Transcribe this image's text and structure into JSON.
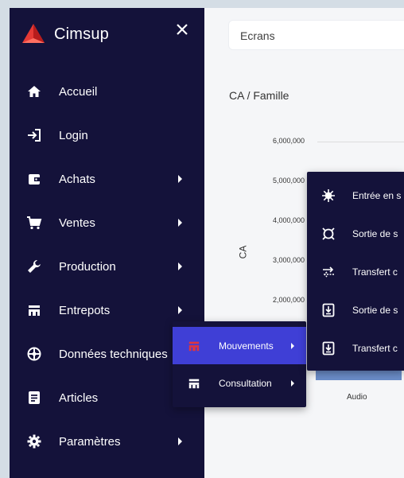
{
  "app": {
    "name": "Cimsup"
  },
  "sidebar": {
    "items": [
      {
        "label": "Accueil",
        "icon": "home-icon",
        "submenu": false
      },
      {
        "label": "Login",
        "icon": "login-icon",
        "submenu": false
      },
      {
        "label": "Achats",
        "icon": "wallet-icon",
        "submenu": true
      },
      {
        "label": "Ventes",
        "icon": "cart-icon",
        "submenu": true
      },
      {
        "label": "Production",
        "icon": "wrench-icon",
        "submenu": true
      },
      {
        "label": "Entrepots",
        "icon": "warehouse-icon",
        "submenu": true
      },
      {
        "label": "Données techniques",
        "icon": "settings-wheel-icon",
        "submenu": false
      },
      {
        "label": "Articles",
        "icon": "document-icon",
        "submenu": false
      },
      {
        "label": "Paramètres",
        "icon": "gear-icon",
        "submenu": true
      }
    ]
  },
  "search": {
    "value": "Ecrans"
  },
  "chart_title": "CA / Famille",
  "chart_data": {
    "type": "bar",
    "title": "CA / Famille",
    "ylabel": "CA",
    "xlabel": "",
    "categories": [
      "Audio"
    ],
    "y_ticks": [
      "6,000,000",
      "5,000,000",
      "4,000,000",
      "3,000,000",
      "2,000,000"
    ],
    "values": [
      500000
    ],
    "ylim": [
      0,
      6000000
    ]
  },
  "entrepots_menu": {
    "items": [
      {
        "label": "Mouvements",
        "icon": "warehouse-icon",
        "active": true,
        "submenu": true
      },
      {
        "label": "Consultation",
        "icon": "warehouse-icon",
        "active": false,
        "submenu": true
      }
    ]
  },
  "mouvements_menu": {
    "items": [
      {
        "label": "Entrée en s",
        "icon": "virus-icon"
      },
      {
        "label": "Sortie de s",
        "icon": "target-icon"
      },
      {
        "label": "Transfert c",
        "icon": "transfer-icon"
      },
      {
        "label": "Sortie de s",
        "icon": "download-box-icon"
      },
      {
        "label": "Transfert c",
        "icon": "download-box-icon"
      }
    ]
  },
  "colors": {
    "sidebar_bg": "#14123a",
    "active_item": "#3f3fd6",
    "active_icon": "#e0353e",
    "bar": "#6b8dc9",
    "logo_red": "#e53935"
  }
}
